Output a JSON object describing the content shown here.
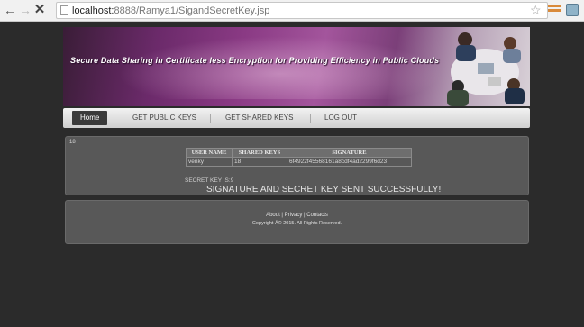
{
  "browser": {
    "url_host": "localhost:",
    "url_rest": "8888/Ramya1/SigandSecretKey.jsp",
    "icons": [
      "back-arrow-icon",
      "forward-arrow-icon",
      "stop-icon",
      "page-icon",
      "bookmark-star-icon",
      "extension-icon",
      "extension-icon"
    ]
  },
  "banner": {
    "title": "Secure Data Sharing in Certificate less Encryption for Providing Efficiency in Public Clouds"
  },
  "menu": {
    "home": "Home",
    "get_public_keys": "GET PUBLIC KEYS",
    "get_shared_keys": "GET SHARED KEYS",
    "logout": "LOG OUT"
  },
  "content": {
    "number": "18",
    "table": {
      "headers": [
        "USER NAME",
        "SHARED KEYS",
        "SIGNATURE"
      ],
      "row": [
        "venky",
        "18",
        "6f4922f45568161a8cdf4ad2299f6d23"
      ]
    },
    "secret_key_text": "SECRET KEY IS:9",
    "success_message": "SIGNATURE AND SECRET KEY SENT SUCCESSFULLY!"
  },
  "footer": {
    "about": "About",
    "sep1": "|",
    "privacy": "Privacy",
    "sep2": "|",
    "contacts": "Contacts",
    "copyright": "Copyright Â© 2015. All Rights Reserved."
  },
  "colors": {
    "page_background": "#2b2b2b",
    "panel": "#585858",
    "menu_active": "#3a3a3a",
    "banner_purple": "#8a3a84"
  }
}
